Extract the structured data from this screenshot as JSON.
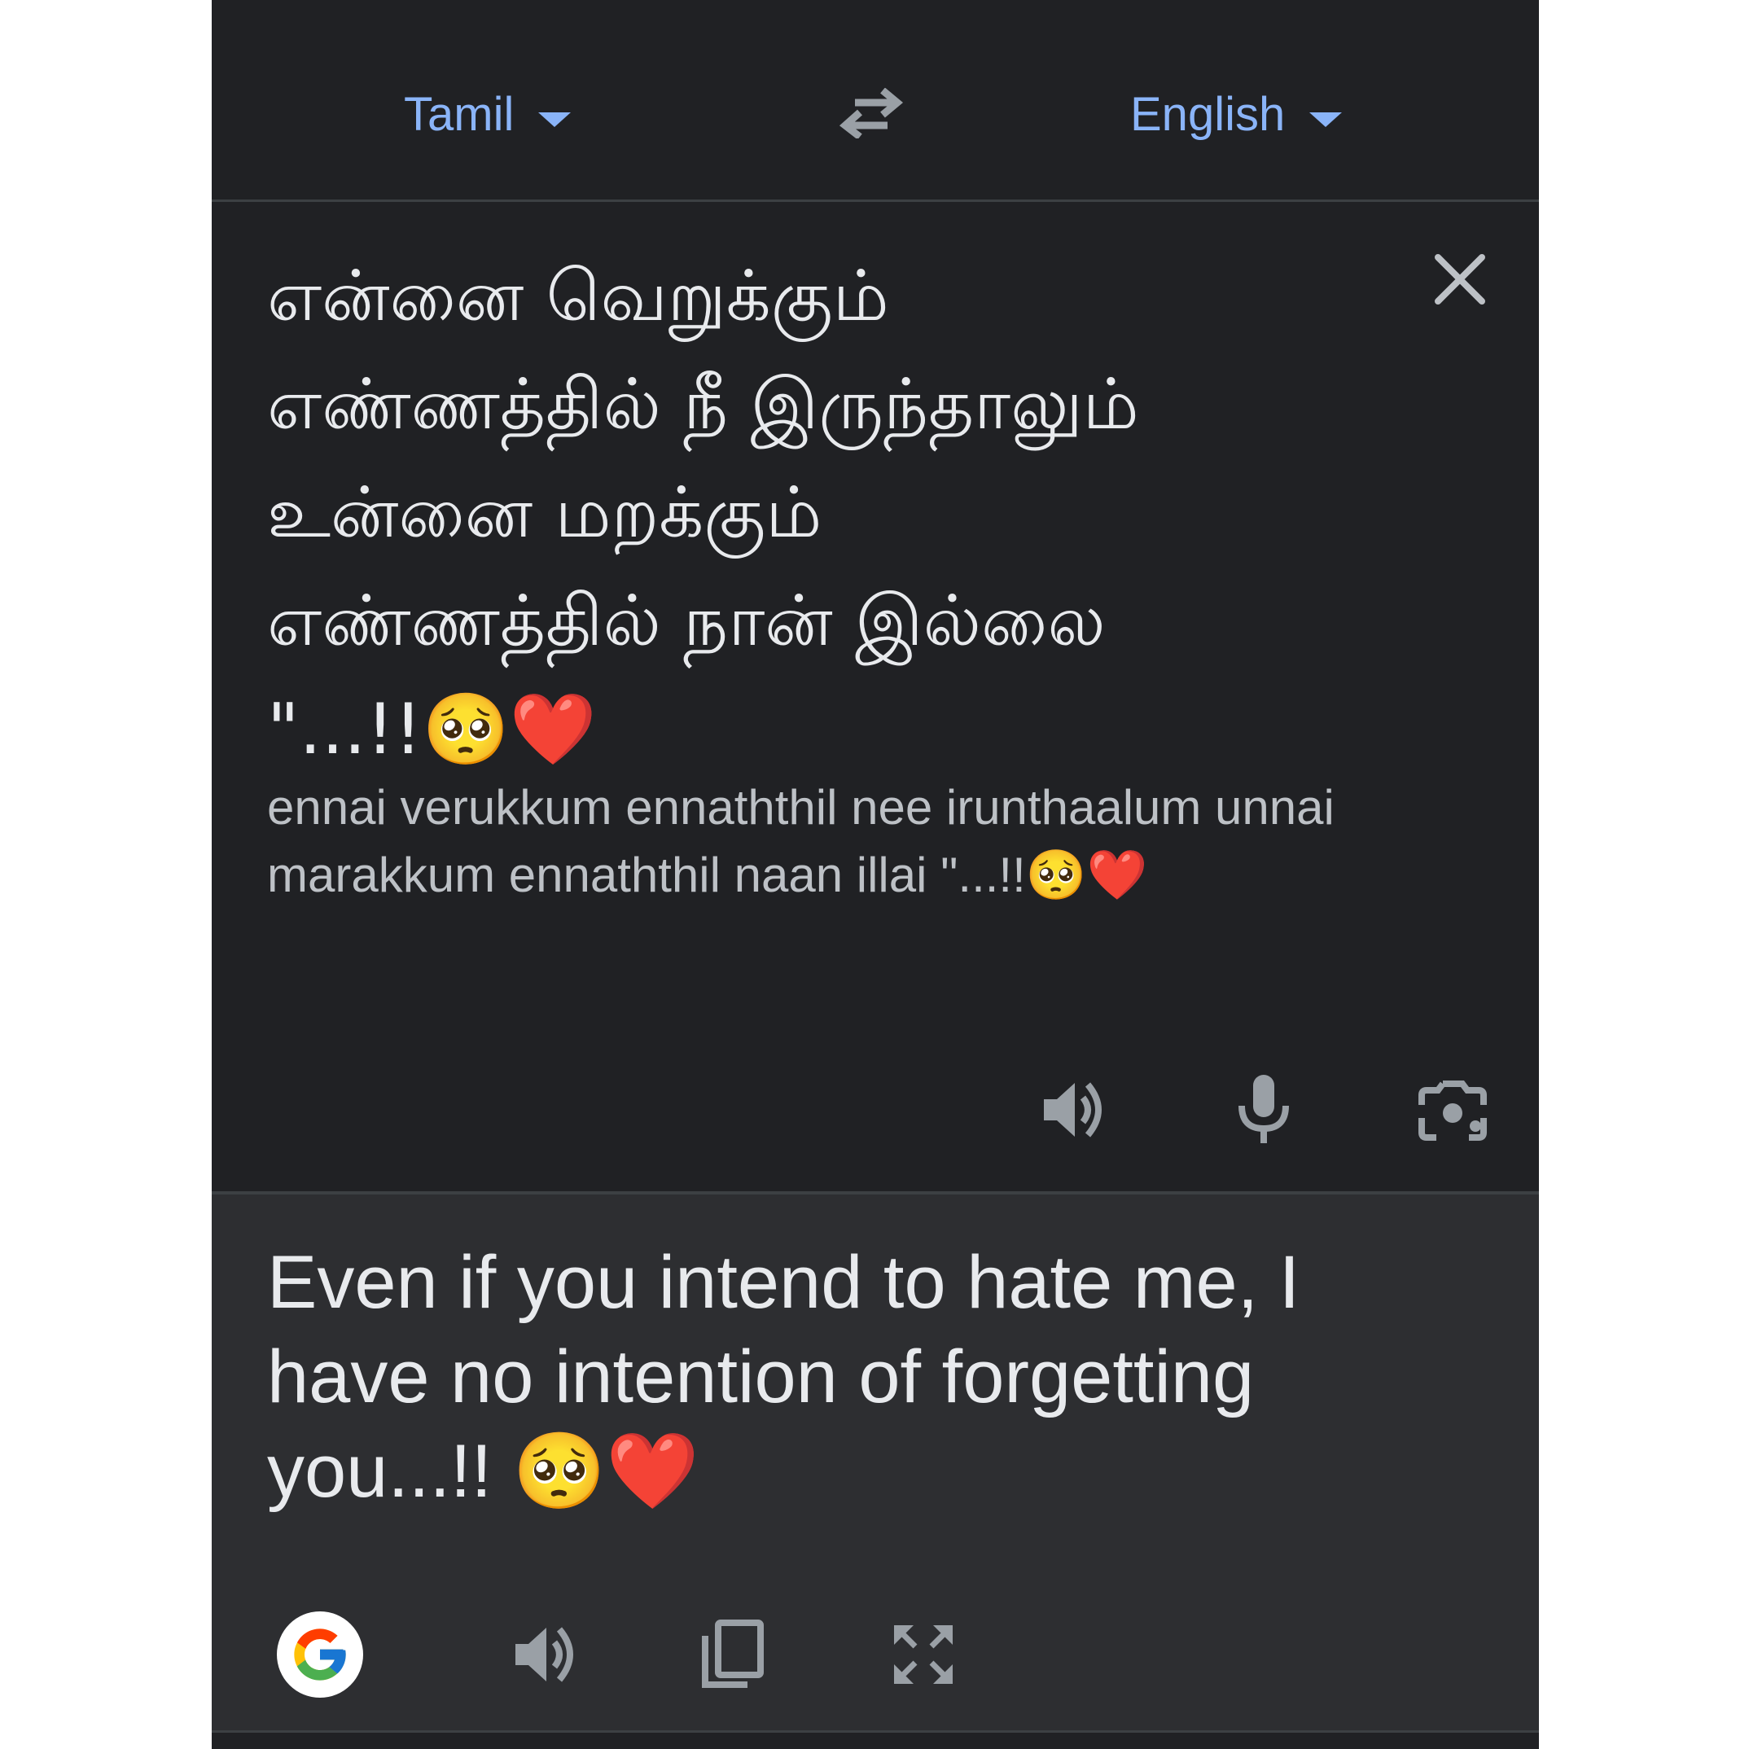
{
  "header": {
    "source_language": "Tamil",
    "target_language": "English",
    "swap_icon": "swap-horiz-icon"
  },
  "input": {
    "source_text": "என்னை வெறுக்கும் எண்ணத்தில் நீ இருந்தாலும் உன்னை மறக்கும் எண்ணத்தில் நான் இல்லை \"...!!🥺❤️",
    "transliteration": "ennai verukkum ennaththil nee irunthaalum unnai marakkum ennaththil naan illai \"...!!🥺❤️",
    "clear_icon": "close-icon",
    "actions": {
      "speak_icon": "volume-icon",
      "mic_icon": "microphone-icon",
      "camera_icon": "camera-icon"
    }
  },
  "output": {
    "translation": "Even if you intend to hate me, I have no intention of forgetting you...!! 🥺❤️",
    "actions": {
      "google_icon": "google-icon",
      "speak_icon": "volume-icon",
      "copy_icon": "copy-icon",
      "fullscreen_icon": "fullscreen-icon"
    }
  },
  "colors": {
    "background": "#202124",
    "output_background": "#2d2e31",
    "accent": "#8ab4f8",
    "text": "#e8eaed",
    "secondary_text": "#bdc1c6",
    "icon": "#9aa0a6"
  }
}
